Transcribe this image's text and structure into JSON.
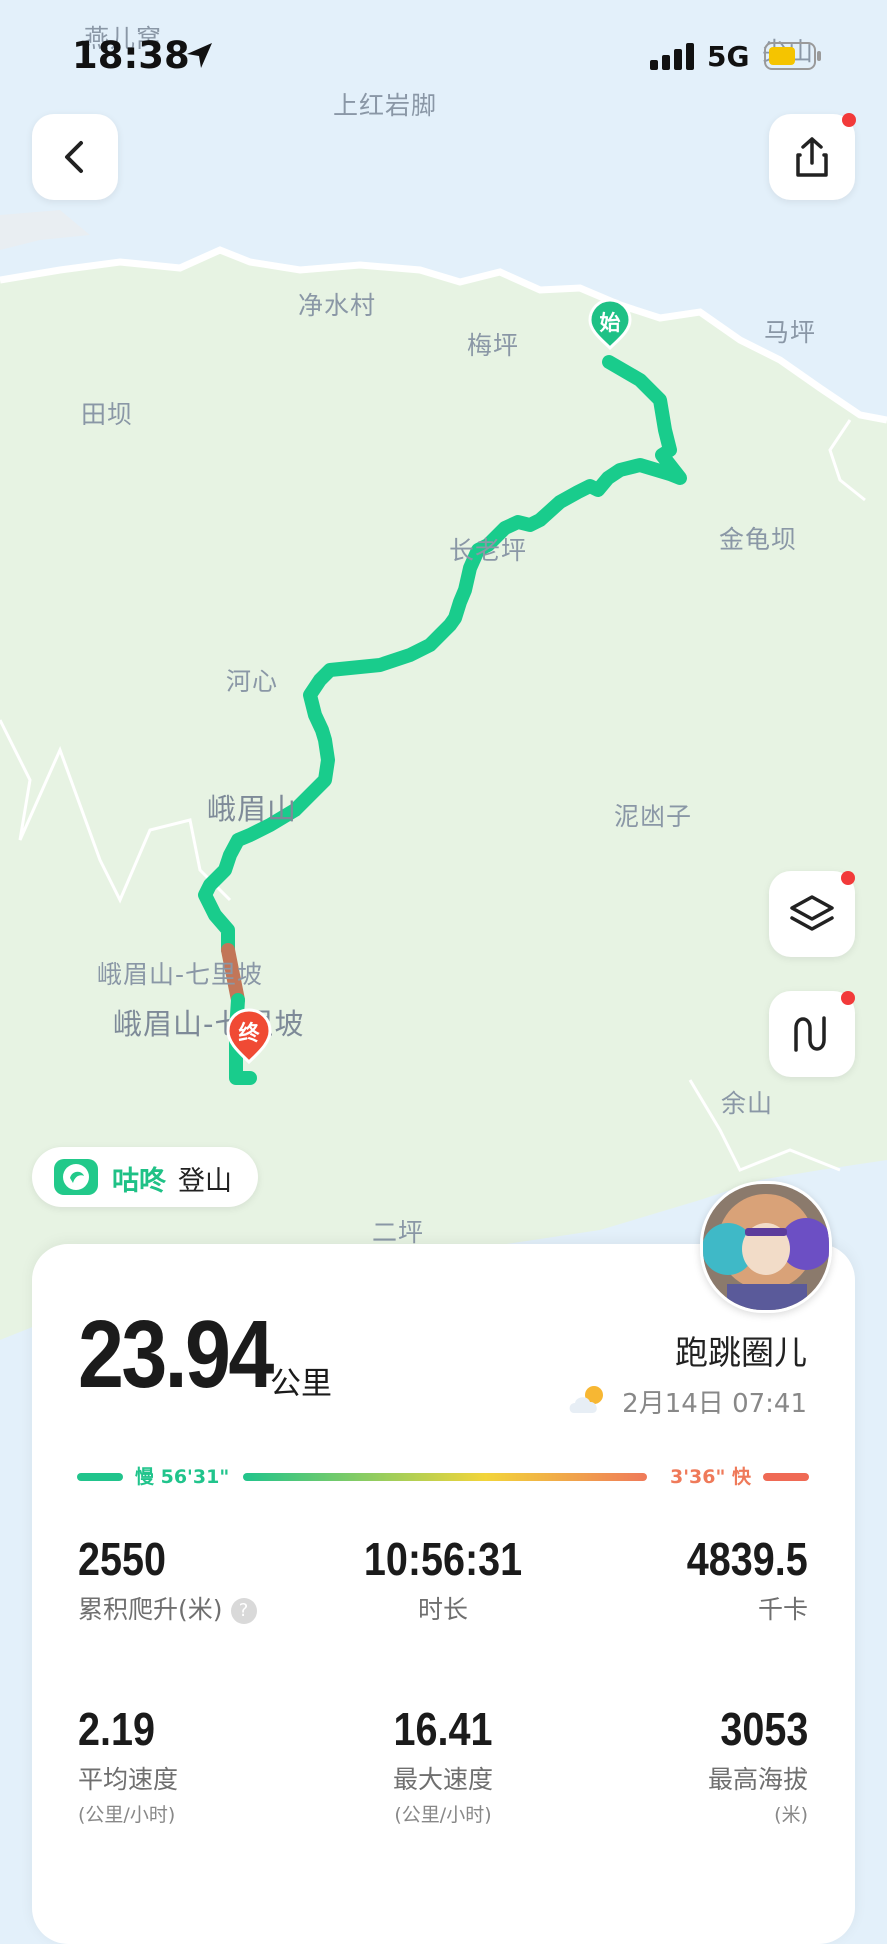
{
  "status_bar": {
    "time": "18:38",
    "network": "5G"
  },
  "map": {
    "places": [
      {
        "name": "燕儿窝"
      },
      {
        "name": "上红岩脚"
      },
      {
        "name": "尖山"
      },
      {
        "name": "净水村"
      },
      {
        "name": "梅坪"
      },
      {
        "name": "马坪"
      },
      {
        "name": "田坝"
      },
      {
        "name": "金龟坝"
      },
      {
        "name": "长老坪"
      },
      {
        "name": "河心"
      },
      {
        "name": "峨眉山"
      },
      {
        "name": "泥凼子"
      },
      {
        "name": "峨眉山-七里坡"
      },
      {
        "name": "峨眉山-七里坡"
      },
      {
        "name": "余山"
      },
      {
        "name": "二坪"
      }
    ],
    "start_marker": "始",
    "end_marker": "终"
  },
  "brand": {
    "name": "咕咚",
    "activity": "登山"
  },
  "summary": {
    "distance": "23.94",
    "distance_unit": "公里",
    "username": "跑跳圈儿",
    "datetime": "2月14日 07:41"
  },
  "pace": {
    "slow_label": "慢 56'31\"",
    "fast_label": "3'36\" 快"
  },
  "stats": {
    "elevation_gain": {
      "value": "2550",
      "label": "累积爬升(米)"
    },
    "duration": {
      "value": "10:56:31",
      "label": "时长"
    },
    "calories": {
      "value": "4839.5",
      "label": "千卡"
    },
    "avg_speed": {
      "value": "2.19",
      "label": "平均速度",
      "unit": "(公里/小时)"
    },
    "max_speed": {
      "value": "16.41",
      "label": "最大速度",
      "unit": "(公里/小时)"
    },
    "max_altitude": {
      "value": "3053",
      "label": "最高海拔",
      "unit": "(米)"
    }
  },
  "colors": {
    "accent_green": "#1fc186",
    "route": "#19cc8c",
    "end_marker": "#f04a34",
    "map_land": "#e7f3e3",
    "map_water": "#e3f0fa"
  }
}
